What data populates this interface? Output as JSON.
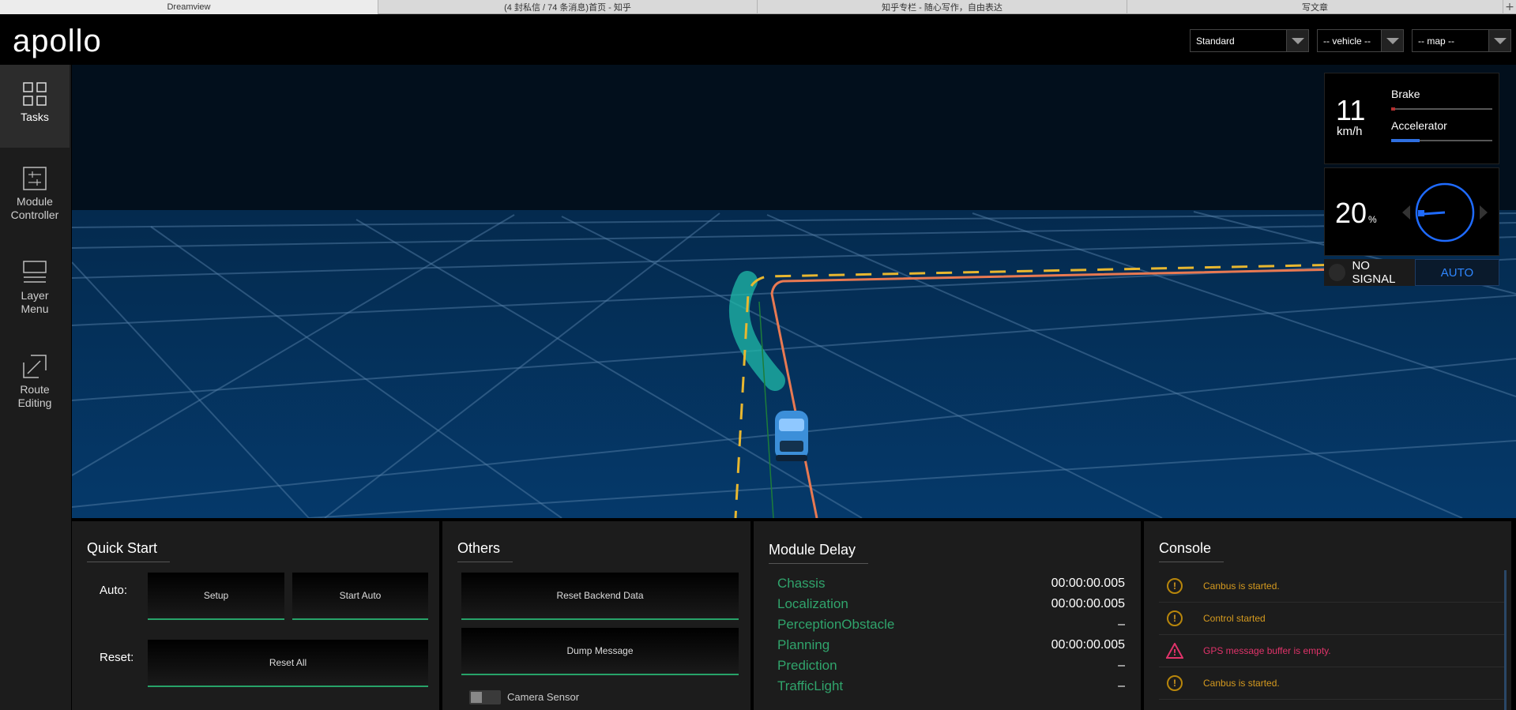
{
  "browser": {
    "tabs": [
      {
        "label": "Dreamview",
        "active": true
      },
      {
        "label": "(4 封私信 / 74 条消息)首页 - 知乎",
        "active": false
      },
      {
        "label": "知乎专栏 - 随心写作，自由表达",
        "active": false
      },
      {
        "label": "写文章",
        "active": false
      }
    ],
    "new_tab": "+"
  },
  "header": {
    "logo": "apollo",
    "mode_select": "Standard",
    "vehicle_select": "-- vehicle --",
    "map_select": "-- map --"
  },
  "sidebar": {
    "items": [
      {
        "label": "Tasks",
        "icon": "grid-icon",
        "active": true
      },
      {
        "label": "Module\nController",
        "icon": "module-controller-icon",
        "active": false
      },
      {
        "label": "Layer\nMenu",
        "icon": "layer-menu-icon",
        "active": false
      },
      {
        "label": "Route\nEditing",
        "icon": "route-editing-icon",
        "active": false
      }
    ]
  },
  "dashboard": {
    "speed": "11",
    "speed_unit": "km/h",
    "brake_label": "Brake",
    "brake_level": 0.04,
    "accelerator_label": "Accelerator",
    "accelerator_level": 0.28,
    "steering": "20",
    "steering_unit": "%",
    "signal": "NO SIGNAL",
    "driving_mode": "AUTO",
    "colors": {
      "brake": "#b33030",
      "accelerator": "#2f6fe0",
      "steering": "#1f6bff"
    }
  },
  "quick_start": {
    "title": "Quick Start",
    "auto_label": "Auto:",
    "setup": "Setup",
    "start_auto": "Start Auto",
    "reset_label": "Reset:",
    "reset_all": "Reset All"
  },
  "others": {
    "title": "Others",
    "reset_backend": "Reset Backend Data",
    "dump_message": "Dump Message",
    "camera_sensor": "Camera Sensor"
  },
  "module_delay": {
    "title": "Module Delay",
    "rows": [
      {
        "name": "Chassis",
        "value": "00:00:00.005"
      },
      {
        "name": "Localization",
        "value": "00:00:00.005"
      },
      {
        "name": "PerceptionObstacle",
        "value": "–"
      },
      {
        "name": "Planning",
        "value": "00:00:00.005"
      },
      {
        "name": "Prediction",
        "value": "–"
      },
      {
        "name": "TrafficLight",
        "value": "–"
      }
    ]
  },
  "console": {
    "title": "Console",
    "messages": [
      {
        "text": "Canbus is started.",
        "level": "warning",
        "color": "#d59a1f"
      },
      {
        "text": "Control started",
        "level": "warning",
        "color": "#d59a1f"
      },
      {
        "text": "GPS message buffer is empty.",
        "level": "error",
        "color": "#e0336a"
      },
      {
        "text": "Canbus is started.",
        "level": "warning",
        "color": "#d59a1f"
      }
    ]
  }
}
